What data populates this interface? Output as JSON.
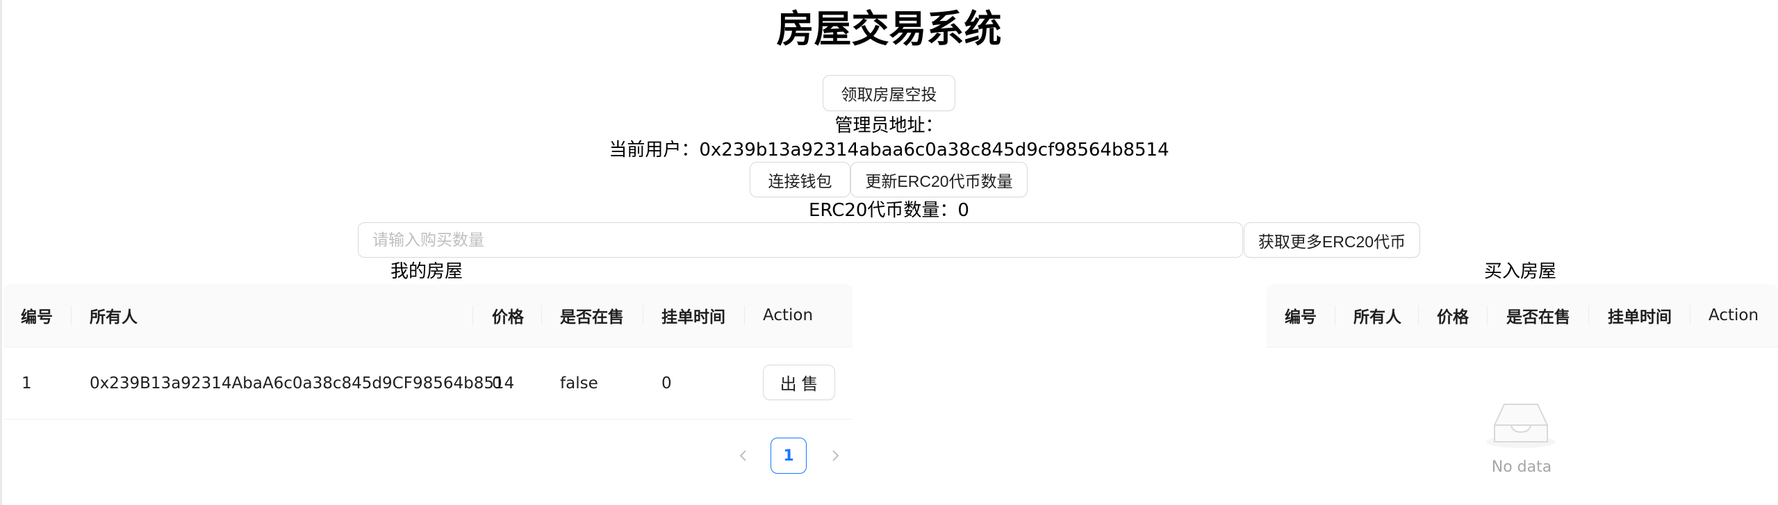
{
  "header": {
    "title": "房屋交易系统"
  },
  "actions": {
    "airdrop_label": "领取房屋空投",
    "connect_wallet_label": "连接钱包",
    "update_erc20_label": "更新ERC20代币数量",
    "get_more_erc20_label": "获取更多ERC20代币"
  },
  "info": {
    "admin_address_label": "管理员地址：",
    "current_user_label": "当前用户：0x239b13a92314abaa6c0a38c845d9cf98564b8514",
    "erc20_balance_label": "ERC20代币数量：0"
  },
  "purchase_input": {
    "placeholder": "请输入购买数量",
    "value": ""
  },
  "my_houses": {
    "title": "我的房屋",
    "columns": [
      "编号",
      "所有人",
      "价格",
      "是否在售",
      "挂单时间",
      "Action"
    ],
    "rows": [
      {
        "id": "1",
        "owner": "0x239B13a92314AbaA6c0a38c845d9CF98564b8514",
        "price": "0",
        "on_sale": "false",
        "listed_time": "0",
        "action_label": "出 售"
      }
    ],
    "pagination": {
      "current_page": "1",
      "prev_icon": "chevron-left-icon",
      "next_icon": "chevron-right-icon"
    }
  },
  "buy_houses": {
    "title": "买入房屋",
    "columns": [
      "编号",
      "所有人",
      "价格",
      "是否在售",
      "挂单时间",
      "Action"
    ],
    "empty_text": "No data",
    "empty_icon": "empty-inbox-icon"
  },
  "colors": {
    "primary": "#1677ff",
    "border": "#d9d9d9",
    "table_header_bg": "#fafafa",
    "placeholder": "#bfbfbf"
  }
}
